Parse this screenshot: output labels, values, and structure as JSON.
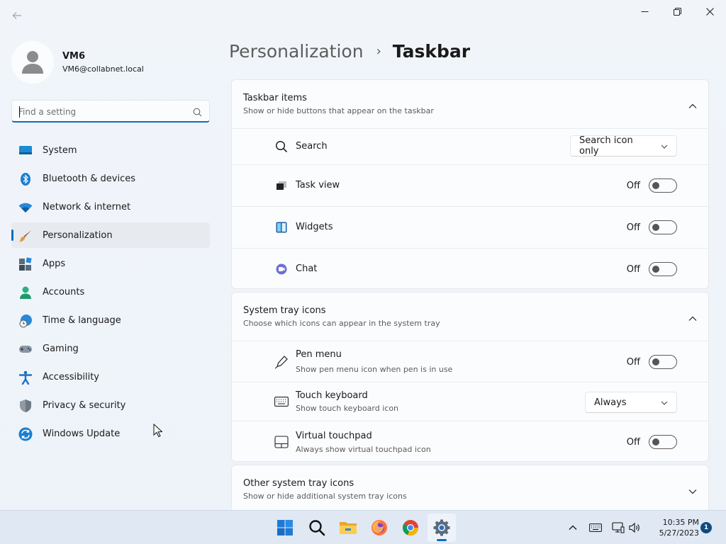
{
  "window": {
    "back_icon": "back-arrow-icon",
    "minimize_icon": "minimize-icon",
    "maximize_icon": "maximize-icon",
    "close_icon": "close-icon"
  },
  "user": {
    "name": "VM6",
    "email": "VM6@collabnet.local"
  },
  "search": {
    "placeholder": "Find a setting",
    "value": ""
  },
  "sidebar": {
    "items": [
      {
        "label": "System",
        "icon": "system-icon"
      },
      {
        "label": "Bluetooth & devices",
        "icon": "bluetooth-icon"
      },
      {
        "label": "Network & internet",
        "icon": "wifi-icon"
      },
      {
        "label": "Personalization",
        "icon": "brush-icon",
        "active": true
      },
      {
        "label": "Apps",
        "icon": "apps-icon"
      },
      {
        "label": "Accounts",
        "icon": "accounts-icon"
      },
      {
        "label": "Time & language",
        "icon": "globe-clock-icon"
      },
      {
        "label": "Gaming",
        "icon": "gamepad-icon"
      },
      {
        "label": "Accessibility",
        "icon": "accessibility-icon"
      },
      {
        "label": "Privacy & security",
        "icon": "shield-icon"
      },
      {
        "label": "Windows Update",
        "icon": "update-icon"
      }
    ]
  },
  "header": {
    "parent": "Personalization",
    "separator": "›",
    "current": "Taskbar"
  },
  "taskbar_items": {
    "title": "Taskbar items",
    "subtitle": "Show or hide buttons that appear on the taskbar",
    "rows": [
      {
        "label": "Search",
        "control": "dropdown",
        "value": "Search icon only"
      },
      {
        "label": "Task view",
        "control": "toggle",
        "state": "Off"
      },
      {
        "label": "Widgets",
        "control": "toggle",
        "state": "Off"
      },
      {
        "label": "Chat",
        "control": "toggle",
        "state": "Off"
      }
    ]
  },
  "system_tray": {
    "title": "System tray icons",
    "subtitle": "Choose which icons can appear in the system tray",
    "rows": [
      {
        "label": "Pen menu",
        "sub": "Show pen menu icon when pen is in use",
        "control": "toggle",
        "state": "Off"
      },
      {
        "label": "Touch keyboard",
        "sub": "Show touch keyboard icon",
        "control": "dropdown",
        "value": "Always"
      },
      {
        "label": "Virtual touchpad",
        "sub": "Always show virtual touchpad icon",
        "control": "toggle",
        "state": "Off"
      }
    ]
  },
  "other_tray": {
    "title": "Other system tray icons",
    "subtitle": "Show or hide additional system tray icons"
  },
  "os_taskbar": {
    "apps": [
      "start-icon",
      "search-icon",
      "file-explorer-icon",
      "firefox-icon",
      "chrome-icon",
      "settings-icon"
    ],
    "tray": [
      "chevron-up-icon",
      "keyboard-icon",
      "network-icon",
      "volume-icon"
    ],
    "time": "10:35 PM",
    "date": "5/27/2023",
    "notification_count": "1"
  },
  "colors": {
    "accent": "#0f6cbd",
    "background": "#eef3f9",
    "card": "#fbfcfd"
  }
}
